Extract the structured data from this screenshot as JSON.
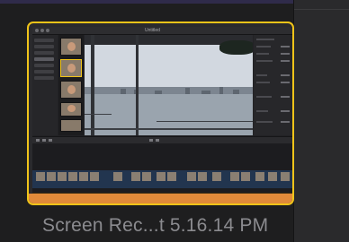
{
  "thumbnail": {
    "label": "Screen Rec...t 5.16.14 PM",
    "selected": true,
    "accent_color": "#f0c419"
  },
  "inner_app": {
    "title": "Untitled"
  }
}
